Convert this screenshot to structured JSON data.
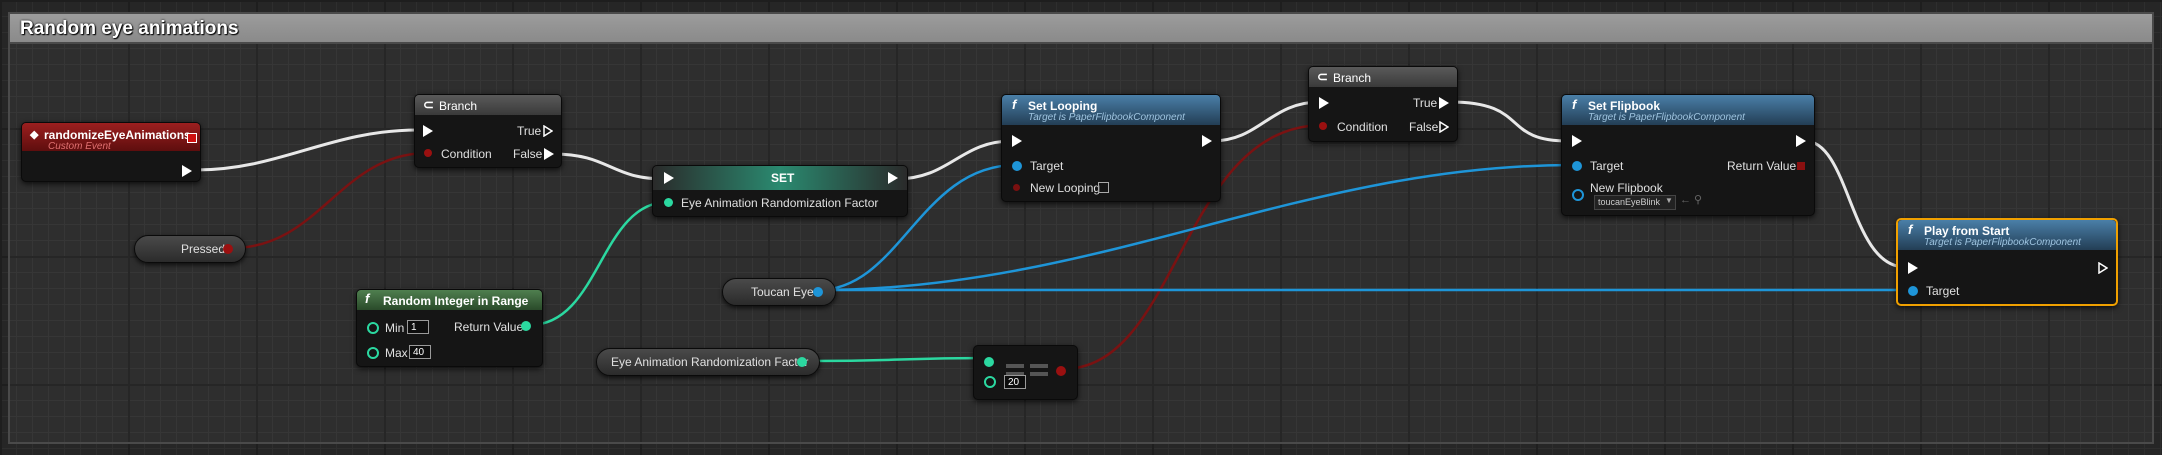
{
  "comment": {
    "title": "Random eye animations"
  },
  "colors": {
    "event_header": "#8a1a1a",
    "function_header": "#3a6f96",
    "pure_function_header": "#3d6b3d",
    "exec_wire": "#ffffff",
    "object_wire": "#1e95d8",
    "int_wire": "#2bd8a0",
    "bool_wire": "#8a1010",
    "selected_border": "#f0a000"
  },
  "nodes": {
    "event": {
      "title": "randomizeEyeAnimations",
      "subtitle": "Custom Event"
    },
    "pressed": {
      "label": "Pressed"
    },
    "branch1": {
      "title": "Branch",
      "condition": "Condition",
      "true": "True",
      "false": "False"
    },
    "random_int": {
      "title": "Random Integer in Range",
      "min_label": "Min",
      "min_value": "1",
      "max_label": "Max",
      "max_value": "40",
      "return_label": "Return Value"
    },
    "set": {
      "title": "SET",
      "var_label": "Eye Animation Randomization Factor"
    },
    "toucan_eye": {
      "label": "Toucan Eye"
    },
    "factor_getter": {
      "label": "Eye Animation Randomization Factor"
    },
    "equal": {
      "value": "20"
    },
    "set_looping": {
      "title": "Set Looping",
      "subtitle": "Target is PaperFlipbookComponent",
      "target": "Target",
      "new_looping": "New Looping"
    },
    "branch2": {
      "title": "Branch",
      "condition": "Condition",
      "true": "True",
      "false": "False"
    },
    "set_flipbook": {
      "title": "Set Flipbook",
      "subtitle": "Target is PaperFlipbookComponent",
      "target": "Target",
      "return_label": "Return Value",
      "new_flipbook": "New Flipbook",
      "flipbook_value": "toucanEyeBlink"
    },
    "play_from_start": {
      "title": "Play from Start",
      "subtitle": "Target is PaperFlipbookComponent",
      "target": "Target"
    }
  }
}
